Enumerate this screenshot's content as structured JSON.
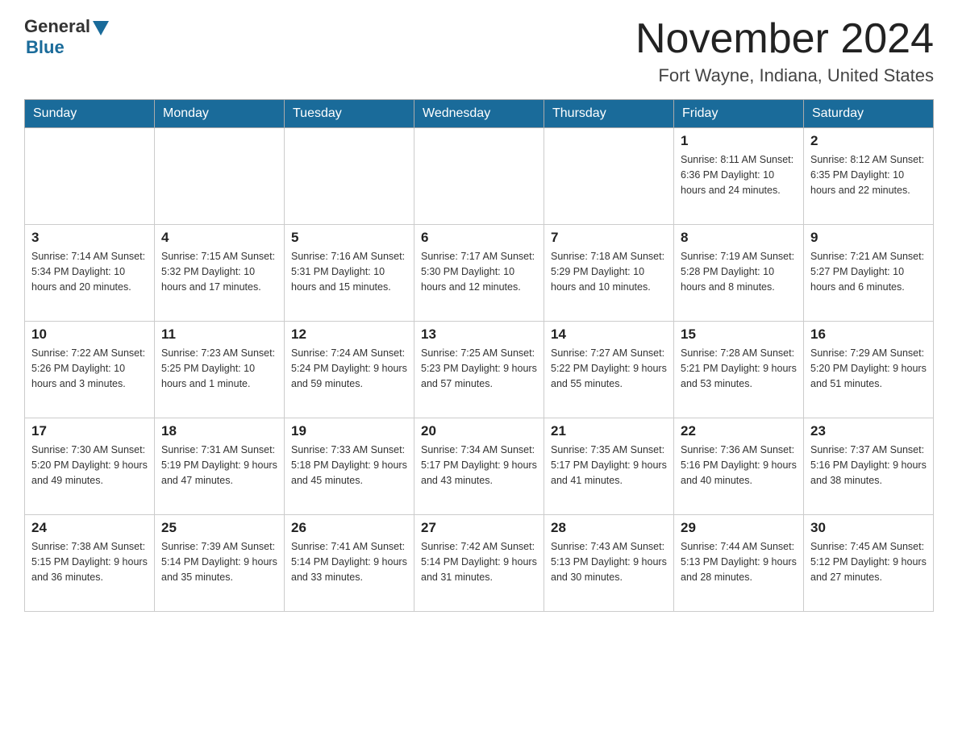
{
  "header": {
    "logo_general": "General",
    "logo_blue": "Blue",
    "month_title": "November 2024",
    "location": "Fort Wayne, Indiana, United States"
  },
  "weekdays": [
    "Sunday",
    "Monday",
    "Tuesday",
    "Wednesday",
    "Thursday",
    "Friday",
    "Saturday"
  ],
  "weeks": [
    [
      {
        "day": "",
        "info": ""
      },
      {
        "day": "",
        "info": ""
      },
      {
        "day": "",
        "info": ""
      },
      {
        "day": "",
        "info": ""
      },
      {
        "day": "",
        "info": ""
      },
      {
        "day": "1",
        "info": "Sunrise: 8:11 AM\nSunset: 6:36 PM\nDaylight: 10 hours\nand 24 minutes."
      },
      {
        "day": "2",
        "info": "Sunrise: 8:12 AM\nSunset: 6:35 PM\nDaylight: 10 hours\nand 22 minutes."
      }
    ],
    [
      {
        "day": "3",
        "info": "Sunrise: 7:14 AM\nSunset: 5:34 PM\nDaylight: 10 hours\nand 20 minutes."
      },
      {
        "day": "4",
        "info": "Sunrise: 7:15 AM\nSunset: 5:32 PM\nDaylight: 10 hours\nand 17 minutes."
      },
      {
        "day": "5",
        "info": "Sunrise: 7:16 AM\nSunset: 5:31 PM\nDaylight: 10 hours\nand 15 minutes."
      },
      {
        "day": "6",
        "info": "Sunrise: 7:17 AM\nSunset: 5:30 PM\nDaylight: 10 hours\nand 12 minutes."
      },
      {
        "day": "7",
        "info": "Sunrise: 7:18 AM\nSunset: 5:29 PM\nDaylight: 10 hours\nand 10 minutes."
      },
      {
        "day": "8",
        "info": "Sunrise: 7:19 AM\nSunset: 5:28 PM\nDaylight: 10 hours\nand 8 minutes."
      },
      {
        "day": "9",
        "info": "Sunrise: 7:21 AM\nSunset: 5:27 PM\nDaylight: 10 hours\nand 6 minutes."
      }
    ],
    [
      {
        "day": "10",
        "info": "Sunrise: 7:22 AM\nSunset: 5:26 PM\nDaylight: 10 hours\nand 3 minutes."
      },
      {
        "day": "11",
        "info": "Sunrise: 7:23 AM\nSunset: 5:25 PM\nDaylight: 10 hours\nand 1 minute."
      },
      {
        "day": "12",
        "info": "Sunrise: 7:24 AM\nSunset: 5:24 PM\nDaylight: 9 hours\nand 59 minutes."
      },
      {
        "day": "13",
        "info": "Sunrise: 7:25 AM\nSunset: 5:23 PM\nDaylight: 9 hours\nand 57 minutes."
      },
      {
        "day": "14",
        "info": "Sunrise: 7:27 AM\nSunset: 5:22 PM\nDaylight: 9 hours\nand 55 minutes."
      },
      {
        "day": "15",
        "info": "Sunrise: 7:28 AM\nSunset: 5:21 PM\nDaylight: 9 hours\nand 53 minutes."
      },
      {
        "day": "16",
        "info": "Sunrise: 7:29 AM\nSunset: 5:20 PM\nDaylight: 9 hours\nand 51 minutes."
      }
    ],
    [
      {
        "day": "17",
        "info": "Sunrise: 7:30 AM\nSunset: 5:20 PM\nDaylight: 9 hours\nand 49 minutes."
      },
      {
        "day": "18",
        "info": "Sunrise: 7:31 AM\nSunset: 5:19 PM\nDaylight: 9 hours\nand 47 minutes."
      },
      {
        "day": "19",
        "info": "Sunrise: 7:33 AM\nSunset: 5:18 PM\nDaylight: 9 hours\nand 45 minutes."
      },
      {
        "day": "20",
        "info": "Sunrise: 7:34 AM\nSunset: 5:17 PM\nDaylight: 9 hours\nand 43 minutes."
      },
      {
        "day": "21",
        "info": "Sunrise: 7:35 AM\nSunset: 5:17 PM\nDaylight: 9 hours\nand 41 minutes."
      },
      {
        "day": "22",
        "info": "Sunrise: 7:36 AM\nSunset: 5:16 PM\nDaylight: 9 hours\nand 40 minutes."
      },
      {
        "day": "23",
        "info": "Sunrise: 7:37 AM\nSunset: 5:16 PM\nDaylight: 9 hours\nand 38 minutes."
      }
    ],
    [
      {
        "day": "24",
        "info": "Sunrise: 7:38 AM\nSunset: 5:15 PM\nDaylight: 9 hours\nand 36 minutes."
      },
      {
        "day": "25",
        "info": "Sunrise: 7:39 AM\nSunset: 5:14 PM\nDaylight: 9 hours\nand 35 minutes."
      },
      {
        "day": "26",
        "info": "Sunrise: 7:41 AM\nSunset: 5:14 PM\nDaylight: 9 hours\nand 33 minutes."
      },
      {
        "day": "27",
        "info": "Sunrise: 7:42 AM\nSunset: 5:14 PM\nDaylight: 9 hours\nand 31 minutes."
      },
      {
        "day": "28",
        "info": "Sunrise: 7:43 AM\nSunset: 5:13 PM\nDaylight: 9 hours\nand 30 minutes."
      },
      {
        "day": "29",
        "info": "Sunrise: 7:44 AM\nSunset: 5:13 PM\nDaylight: 9 hours\nand 28 minutes."
      },
      {
        "day": "30",
        "info": "Sunrise: 7:45 AM\nSunset: 5:12 PM\nDaylight: 9 hours\nand 27 minutes."
      }
    ]
  ]
}
